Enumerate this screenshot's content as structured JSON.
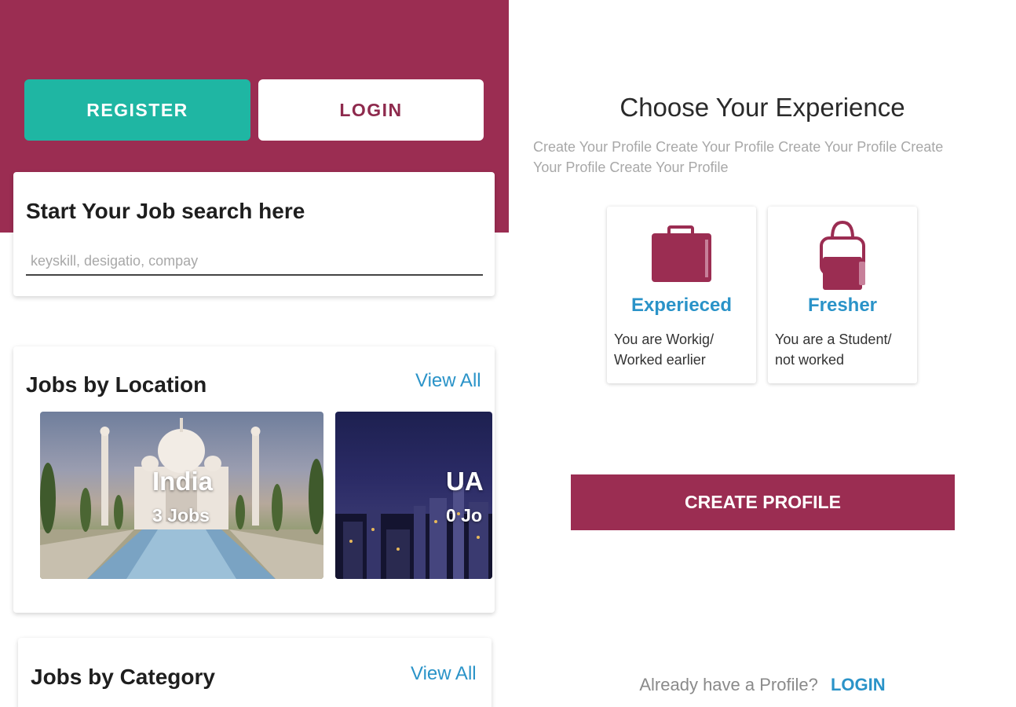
{
  "left": {
    "register_label": "REGISTER",
    "login_label": "LOGIN",
    "search": {
      "title": "Start Your Job search here",
      "placeholder": "keyskill, desigatio, compay"
    },
    "jobs_by_location": {
      "title": "Jobs by Location",
      "view_all": "View All",
      "tiles": [
        {
          "name": "India",
          "count": "3 Jobs"
        },
        {
          "name": "UA",
          "count": "0 Jo"
        }
      ]
    },
    "jobs_by_category": {
      "title": "Jobs by Category",
      "view_all": "View All"
    }
  },
  "right": {
    "title": "Choose Your Experience",
    "description": "Create Your Profile Create Your Profile Create Your Profile Create Your Profile Create Your Profile",
    "options": [
      {
        "title": "Experieced",
        "desc": "You are Workig/ Worked earlier",
        "icon": "briefcase-icon"
      },
      {
        "title": "Fresher",
        "desc": "You are a Student/ not worked",
        "icon": "backpack-icon"
      }
    ],
    "create_profile_label": "CREATE PROFILE",
    "already_text": "Already have a Profile?",
    "login_link": "LOGIN"
  },
  "colors": {
    "brand": "#9b2d52",
    "teal": "#1fb6a3",
    "link": "#2a93c8"
  }
}
